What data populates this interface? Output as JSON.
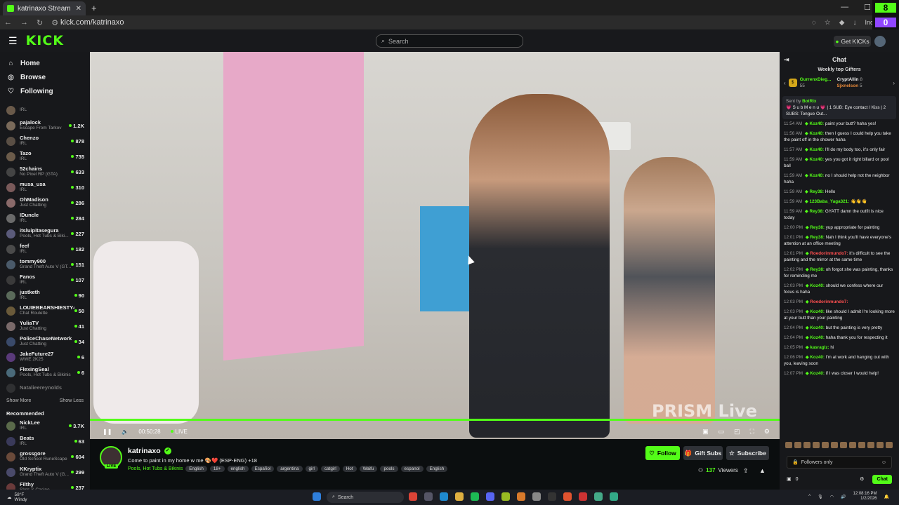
{
  "browser": {
    "tab_title": "katrinaxo Stream - Watch L",
    "tab_close": "✕",
    "new_tab": "+",
    "url": "kick.com/katrinaxo",
    "incognito": "Incognito",
    "win_min": "—",
    "win_max": "☐",
    "corner_top": "8",
    "corner_bottom": "0"
  },
  "header": {
    "logo": "KICK",
    "search_placeholder": "Search",
    "get_kicks": "Get KICKs"
  },
  "sidebar": {
    "nav": [
      {
        "label": "Home",
        "icon": "home-icon",
        "glyph": "⌂"
      },
      {
        "label": "Browse",
        "icon": "browse-icon",
        "glyph": "◎"
      },
      {
        "label": "Following",
        "icon": "heart-icon",
        "glyph": "♡"
      }
    ],
    "following": [
      {
        "name": "",
        "category": "IRL",
        "viewers": "",
        "color": "#6a5a4a"
      },
      {
        "name": "pajalock",
        "category": "Escape From Tarkov",
        "viewers": "1.2K",
        "color": "#7a6a5a"
      },
      {
        "name": "Chenzo",
        "category": "IRL",
        "viewers": "878",
        "color": "#5a4f45"
      },
      {
        "name": "Tazo",
        "category": "IRL",
        "viewers": "735",
        "color": "#6b5b4a"
      },
      {
        "name": "52chains",
        "category": "No Pixel RP (GTA)",
        "viewers": "633",
        "color": "#444"
      },
      {
        "name": "musa_usa",
        "category": "IRL",
        "viewers": "310",
        "color": "#7a5a5a"
      },
      {
        "name": "OhMadison",
        "category": "Just Chatting",
        "viewers": "286",
        "color": "#8a6a6a"
      },
      {
        "name": "IDuncle",
        "category": "IRL",
        "viewers": "284",
        "color": "#6a6a6a"
      },
      {
        "name": "itsluipitasegura",
        "category": "Pools, Hot Tubs & Biki...",
        "viewers": "227",
        "color": "#5a5a7a"
      },
      {
        "name": "feef",
        "category": "IRL",
        "viewers": "182",
        "color": "#4a4a4a"
      },
      {
        "name": "tommy900",
        "category": "Grand Theft Auto V (GT...",
        "viewers": "151",
        "color": "#4a5a6a"
      },
      {
        "name": "Fanos",
        "category": "IRL",
        "viewers": "107",
        "color": "#3a3a3a"
      },
      {
        "name": "justketh",
        "category": "IRL",
        "viewers": "90",
        "color": "#5a6a5a"
      },
      {
        "name": "LOUIEBEARSHIESTY4",
        "category": "Chat Roulette",
        "viewers": "50",
        "color": "#6a5a3a"
      },
      {
        "name": "YuliaTV",
        "category": "Just Chatting",
        "viewers": "41",
        "color": "#7a6a6a"
      },
      {
        "name": "PoliceChaseNetwork",
        "category": "Just Chatting",
        "viewers": "34",
        "color": "#3a4a6a"
      },
      {
        "name": "JakeFuture27",
        "category": "WWE 2K25",
        "viewers": "6",
        "color": "#5a3a7a"
      },
      {
        "name": "FlexingSeal",
        "category": "Pools, Hot Tubs & Bikinis",
        "viewers": "6",
        "color": "#4a6a7a"
      },
      {
        "name": "Natalieereynolds",
        "category": "",
        "viewers": "",
        "color": "#555",
        "offline": true
      }
    ],
    "show_more": "Show More",
    "show_less": "Show Less",
    "recommended_heading": "Recommended",
    "recommended": [
      {
        "name": "NickLee",
        "category": "IRL",
        "viewers": "3.7K",
        "color": "#5a6a4a"
      },
      {
        "name": "Beats",
        "category": "IRL",
        "viewers": "63",
        "color": "#3a3a5a"
      },
      {
        "name": "grossgore",
        "category": "Old School RuneScape",
        "viewers": "604",
        "color": "#6a4a3a"
      },
      {
        "name": "KKryptix",
        "category": "Grand Theft Auto V (G...",
        "viewers": "299",
        "color": "#4a4a6a"
      },
      {
        "name": "Filthy",
        "category": "Slots & Casino",
        "viewers": "237",
        "color": "#6a3a3a"
      }
    ]
  },
  "video": {
    "watermark": "PRISM Live",
    "time": "00:50:28",
    "live_label": "LIVE"
  },
  "stream": {
    "name": "katrinaxo",
    "live_badge": "LIVE",
    "title": "Come to paint in my home w me 🎨❤️ (ESP-ENG) +18",
    "category": "Pools, Hot Tubs & Bikinis",
    "tags": [
      "English",
      "18+",
      "english",
      "Español",
      "argentina",
      "girl",
      "catgirl",
      "Hot",
      "Waifu",
      "pools",
      "espanol",
      "English"
    ],
    "follow": "Follow",
    "gift_subs": "Gift Subs",
    "subscribe": "Subscribe",
    "viewers": "137",
    "viewers_label": "Viewers"
  },
  "chat": {
    "title": "Chat",
    "gifters_heading": "Weekly top Gifters",
    "gifters": [
      {
        "name": "GurrenxDieg...",
        "count": "55"
      },
      {
        "name": "CryptAllin",
        "count": "8"
      },
      {
        "name": "Sjxnelson",
        "count": "5"
      }
    ],
    "pinned_sender": "Sent by",
    "pinned_user": "BotRix",
    "pinned_text": "💗 S u b M e n u 💗 | 1 SUB: Eye contact / Kiss | 2 SUBS: Tongue Out...",
    "messages": [
      {
        "time": "11:54 AM",
        "user": "Koz40:",
        "color": "#53fc18",
        "text": "paint your butt? haha yes!"
      },
      {
        "time": "11:56 AM",
        "user": "Koz40:",
        "color": "#53fc18",
        "text": "then I guess I could help you take the paint off in the shower haha"
      },
      {
        "time": "11:57 AM",
        "user": "Koz40:",
        "color": "#53fc18",
        "text": "I'll do my body too, it's only fair"
      },
      {
        "time": "11:59 AM",
        "user": "Koz40:",
        "color": "#53fc18",
        "text": "yes you got it right billard or pool ball"
      },
      {
        "time": "11:59 AM",
        "user": "Koz40:",
        "color": "#53fc18",
        "text": "no I should help not the neighbor haha"
      },
      {
        "time": "11:59 AM",
        "user": "Rey38:",
        "color": "#53fc18",
        "text": "Hello"
      },
      {
        "time": "11:59 AM",
        "user": "123Baba_Yaga321:",
        "color": "#53fc18",
        "text": "👋👋👋"
      },
      {
        "time": "11:59 AM",
        "user": "Rey38:",
        "color": "#53fc18",
        "text": "GYATT damn the outfit is nice today"
      },
      {
        "time": "12:00 PM",
        "user": "Rey38:",
        "color": "#53fc18",
        "text": "yup appropriate for painting"
      },
      {
        "time": "12:01 PM",
        "user": "Rey38:",
        "color": "#53fc18",
        "text": "Nah I think you'll have everyone's attention at an office meeting"
      },
      {
        "time": "12:01 PM",
        "user": "Roedorinmundo7:",
        "color": "#ff4f4f",
        "text": "it's difficult to see the painting and the mirror at the same time"
      },
      {
        "time": "12:02 PM",
        "user": "Rey38:",
        "color": "#53fc18",
        "text": "oh forgot she was painting, thanks for reminding me"
      },
      {
        "time": "12:03 PM",
        "user": "Koz40:",
        "color": "#53fc18",
        "text": "should we confess where our focus is haha"
      },
      {
        "time": "12:03 PM",
        "user": "Roedorinmundo7:",
        "color": "#ff4f4f",
        "text": ""
      },
      {
        "time": "12:03 PM",
        "user": "Koz40:",
        "color": "#53fc18",
        "text": "like should I admit I'm looking more at your butt than your painting"
      },
      {
        "time": "12:04 PM",
        "user": "Koz40:",
        "color": "#53fc18",
        "text": "but the painting is very pretty"
      },
      {
        "time": "12:04 PM",
        "user": "Koz40:",
        "color": "#53fc18",
        "text": "haha thank you for respecting it"
      },
      {
        "time": "12:05 PM",
        "user": "kasraglz:",
        "color": "#53fc18",
        "text": "hi"
      },
      {
        "time": "12:06 PM",
        "user": "Koz40:",
        "color": "#53fc18",
        "text": "I'm at work and hanging out with you, leaving soon"
      },
      {
        "time": "12:07 PM",
        "user": "Koz40:",
        "color": "#53fc18",
        "text": "if I was closer I would help!"
      }
    ],
    "followers_only": "Followers only",
    "points": "0",
    "chat_button": "Chat"
  },
  "taskbar": {
    "temp": "58°F",
    "weather": "Windy",
    "search": "Search",
    "time": "12:08:16 PM",
    "date": "1/2/2026"
  }
}
